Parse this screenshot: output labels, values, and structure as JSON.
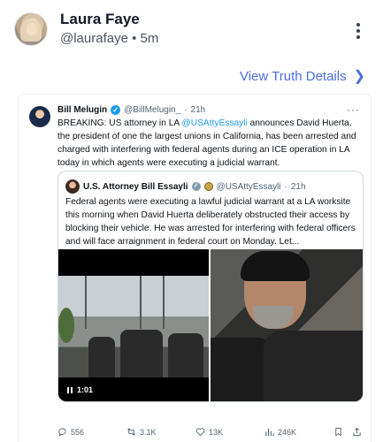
{
  "post": {
    "author_name": "Laura Faye",
    "handle": "@laurafaye",
    "separator": "•",
    "time": "5m",
    "details_link": "View Truth Details",
    "details_chevron": "❯"
  },
  "tweet": {
    "author_name": "Bill Melugin",
    "verified_mark": "✓",
    "handle": "@BillMelugin_",
    "dot": "·",
    "time": "21h",
    "more": "···",
    "text_before": "BREAKING: US attorney in LA ",
    "mention": "@USAttyEssayli",
    "text_after": " announces David Huerta, the president of one the largest unions in California, has been arrested and charged with interfering with federal agents during an ICE operation in LA today in which agents were executing a judicial warrant.",
    "quote": {
      "author_name": "U.S. Attorney Bill Essayli",
      "handle": "@USAttyEssayli",
      "dot": "·",
      "time": "21h",
      "grey_badge_mark": "✓",
      "text": "Federal agents were executing a lawful judicial warrant at a LA worksite this morning when David Huerta deliberately obstructed their access by blocking their vehicle. He was arrested for interfering with federal officers and will face arraignment in federal court on Monday. Let..."
    },
    "video_duration": "1:01",
    "actions": {
      "replies": "556",
      "reposts": "3.1K",
      "likes": "13K",
      "views": "246K"
    }
  },
  "colors": {
    "link_blue": "#4a6ee0",
    "twitter_blue": "#1d9bf0",
    "muted": "#536471"
  }
}
